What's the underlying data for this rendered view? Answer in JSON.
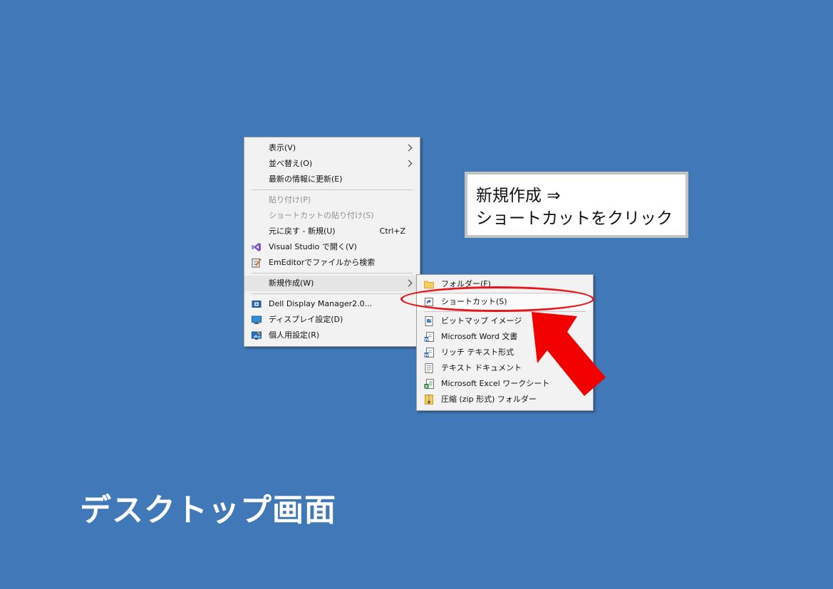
{
  "context_menu": {
    "items": [
      {
        "label": "表示(V)"
      },
      {
        "label": "並べ替え(O)"
      },
      {
        "label": "最新の情報に更新(E)"
      },
      {
        "label": "貼り付け(P)"
      },
      {
        "label": "ショートカットの貼り付け(S)"
      },
      {
        "label": "元に戻す - 新規(U)",
        "shortcut": "Ctrl+Z"
      },
      {
        "label": "Visual Studio で開く(V)",
        "icon": "visual-studio-icon"
      },
      {
        "label": "EmEditorでファイルから検索",
        "icon": "emeditor-icon"
      },
      {
        "label": "新規作成(W)"
      },
      {
        "label": "Dell Display Manager2.0...",
        "icon": "dell-display-icon"
      },
      {
        "label": "ディスプレイ設定(D)",
        "icon": "display-icon"
      },
      {
        "label": "個人用設定(R)",
        "icon": "personalize-icon"
      }
    ]
  },
  "new_submenu": {
    "items": [
      {
        "label": "フォルダー(F)",
        "icon": "folder-icon"
      },
      {
        "label": "ショートカット(S)",
        "icon": "shortcut-icon"
      },
      {
        "label": "ビットマップ イメージ",
        "icon": "bitmap-icon"
      },
      {
        "label": "Microsoft Word 文書",
        "icon": "word-icon"
      },
      {
        "label": "リッチ テキスト形式",
        "icon": "rtf-icon"
      },
      {
        "label": "テキスト ドキュメント",
        "icon": "text-document-icon"
      },
      {
        "label": "Microsoft Excel ワークシート",
        "icon": "excel-icon"
      },
      {
        "label": "圧縮 (zip 形式) フォルダー",
        "icon": "zip-folder-icon"
      }
    ]
  },
  "callout": {
    "line1": "新規作成 ⇒",
    "line2": "ショートカットをクリック"
  },
  "page_title": "デスクトップ画面",
  "colors": {
    "desktop_background": "#4178b8",
    "annotation_red": "#e8161c"
  }
}
